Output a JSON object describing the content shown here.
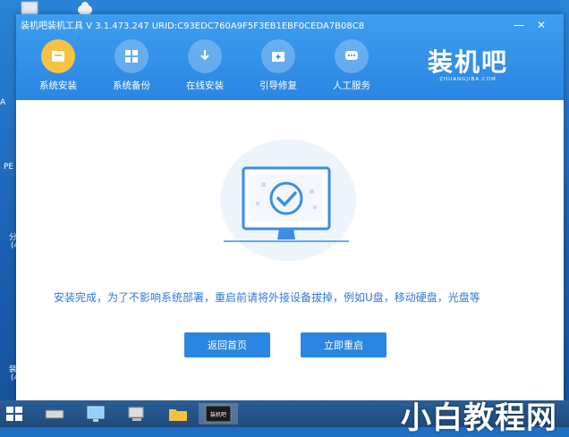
{
  "window": {
    "title": "装机吧装机工具 V 3.1.473.247 URID:C93EDC760A9F5F3EB1EBF0CEDA7B08C8",
    "minimize": "—",
    "close": "✕"
  },
  "nav": [
    {
      "label": "系统安装",
      "icon": "system-install-icon"
    },
    {
      "label": "系统备份",
      "icon": "system-backup-icon"
    },
    {
      "label": "在线安装",
      "icon": "online-install-icon"
    },
    {
      "label": "引导修复",
      "icon": "boot-repair-icon"
    },
    {
      "label": "人工服务",
      "icon": "chat-service-icon"
    }
  ],
  "brand": {
    "main": "装机吧",
    "sub": "ZHUANGJIBA.COM"
  },
  "content": {
    "message": "安装完成，为了不影响系统部署，重启前请将外接设备拔掉，例如U盘，移动硬盘，光盘等",
    "back_button": "返回首页",
    "restart_button": "立即重启"
  },
  "desktop_icons": [
    "A",
    "PE",
    "分",
    "(4",
    "装",
    "(4"
  ],
  "taskbar": {
    "active_label": "装机吧"
  },
  "watermark": {
    "text": "小白教程网"
  },
  "colors": {
    "accent": "#2a86e2",
    "message": "#2f78d8",
    "active_nav": "#f5c242"
  }
}
